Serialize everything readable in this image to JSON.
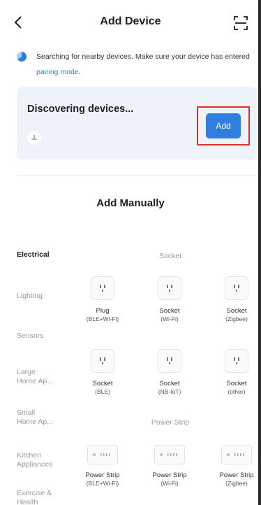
{
  "header": {
    "title": "Add Device",
    "back_icon": "chevron-left-icon",
    "scan_icon": "scan-icon"
  },
  "notice": {
    "text": "Searching for nearby devices. Make sure your device has entered ",
    "link": "pairing mode",
    "suffix": "."
  },
  "discover": {
    "title": "Discovering devices...",
    "add_label": "Add"
  },
  "manual": {
    "title": "Add Manually"
  },
  "categories": [
    {
      "label": "Electrical",
      "active": true
    },
    {
      "label": "Lighting",
      "active": false
    },
    {
      "label": "Sensors",
      "active": false
    },
    {
      "label": "Large Home Ap...",
      "active": false
    },
    {
      "label": "Small Home Ap...",
      "active": false
    },
    {
      "label": "Kitchen Appliances",
      "active": false
    },
    {
      "label": "Exercise & Health",
      "active": false
    }
  ],
  "sections": {
    "socket": "Socket",
    "power_strip": "Power Strip"
  },
  "devices": [
    {
      "name": "Plug",
      "sub": "(BLE+Wi-Fi)",
      "icon": "socket-icon"
    },
    {
      "name": "Socket",
      "sub": "(Wi-Fi)",
      "icon": "socket-icon"
    },
    {
      "name": "Socket",
      "sub": "(Zigbee)",
      "icon": "socket-icon"
    },
    {
      "name": "Socket",
      "sub": "(BLE)",
      "icon": "socket-icon"
    },
    {
      "name": "Socket",
      "sub": "(NB-IoT)",
      "icon": "socket-icon"
    },
    {
      "name": "Socket",
      "sub": "(other)",
      "icon": "socket-icon"
    },
    {
      "name": "Power Strip",
      "sub": "(BLE+Wi-Fi)",
      "icon": "power-strip-icon"
    },
    {
      "name": "Power Strip",
      "sub": "(Wi-Fi)",
      "icon": "power-strip-icon"
    },
    {
      "name": "Power Strip",
      "sub": "(Zigbee)",
      "icon": "power-strip-icon"
    }
  ],
  "colors": {
    "accent": "#2f7fe0",
    "highlight_box": "#e0302b",
    "card_bg": "#edf3f8"
  }
}
